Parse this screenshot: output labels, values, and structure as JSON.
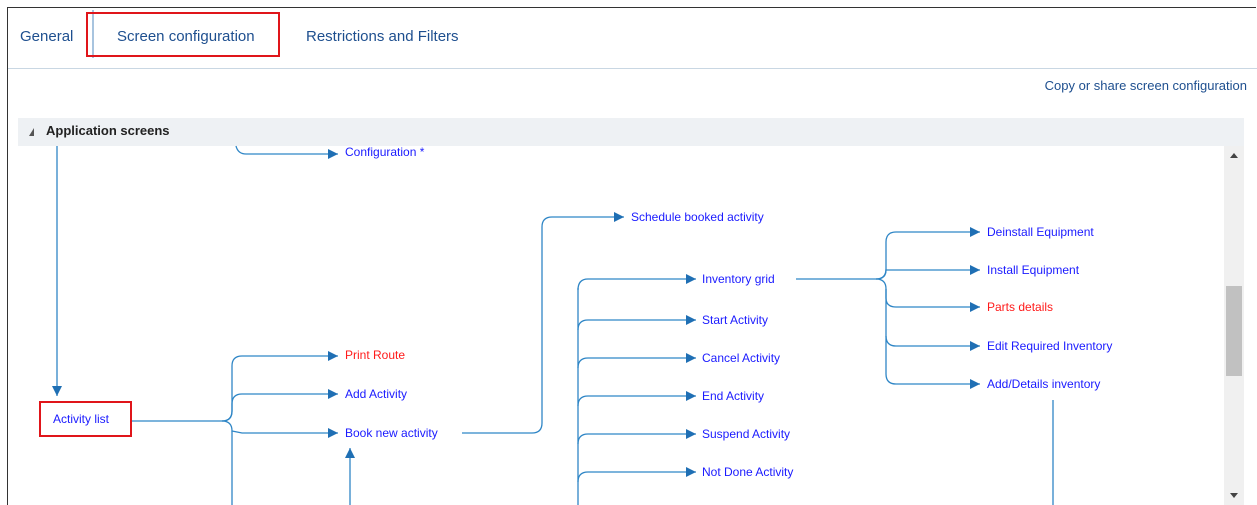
{
  "tabs": {
    "general": "General",
    "screen_configuration": "Screen configuration",
    "restrictions": "Restrictions and Filters"
  },
  "copy_link": "Copy or share screen configuration",
  "panel": {
    "title": "Application screens"
  },
  "nodes": {
    "configuration": "Configuration *",
    "schedule_booked_activity": "Schedule booked activity",
    "deinstall_equipment": "Deinstall Equipment",
    "install_equipment": "Install Equipment",
    "parts_details": "Parts details",
    "edit_required_inventory": "Edit Required Inventory",
    "add_details_inventory": "Add/Details inventory",
    "inventory_grid": "Inventory grid",
    "start_activity": "Start Activity",
    "cancel_activity": "Cancel Activity",
    "end_activity": "End Activity",
    "suspend_activity": "Suspend Activity",
    "not_done_activity": "Not Done Activity",
    "print_route": "Print Route",
    "add_activity": "Add Activity",
    "book_new_activity": "Book new activity",
    "activity_list": "Activity list"
  },
  "colors": {
    "link": "#1a1aff",
    "warning": "#ff1a1a",
    "connector": "#2f86c6",
    "highlight": "#e0151a"
  }
}
